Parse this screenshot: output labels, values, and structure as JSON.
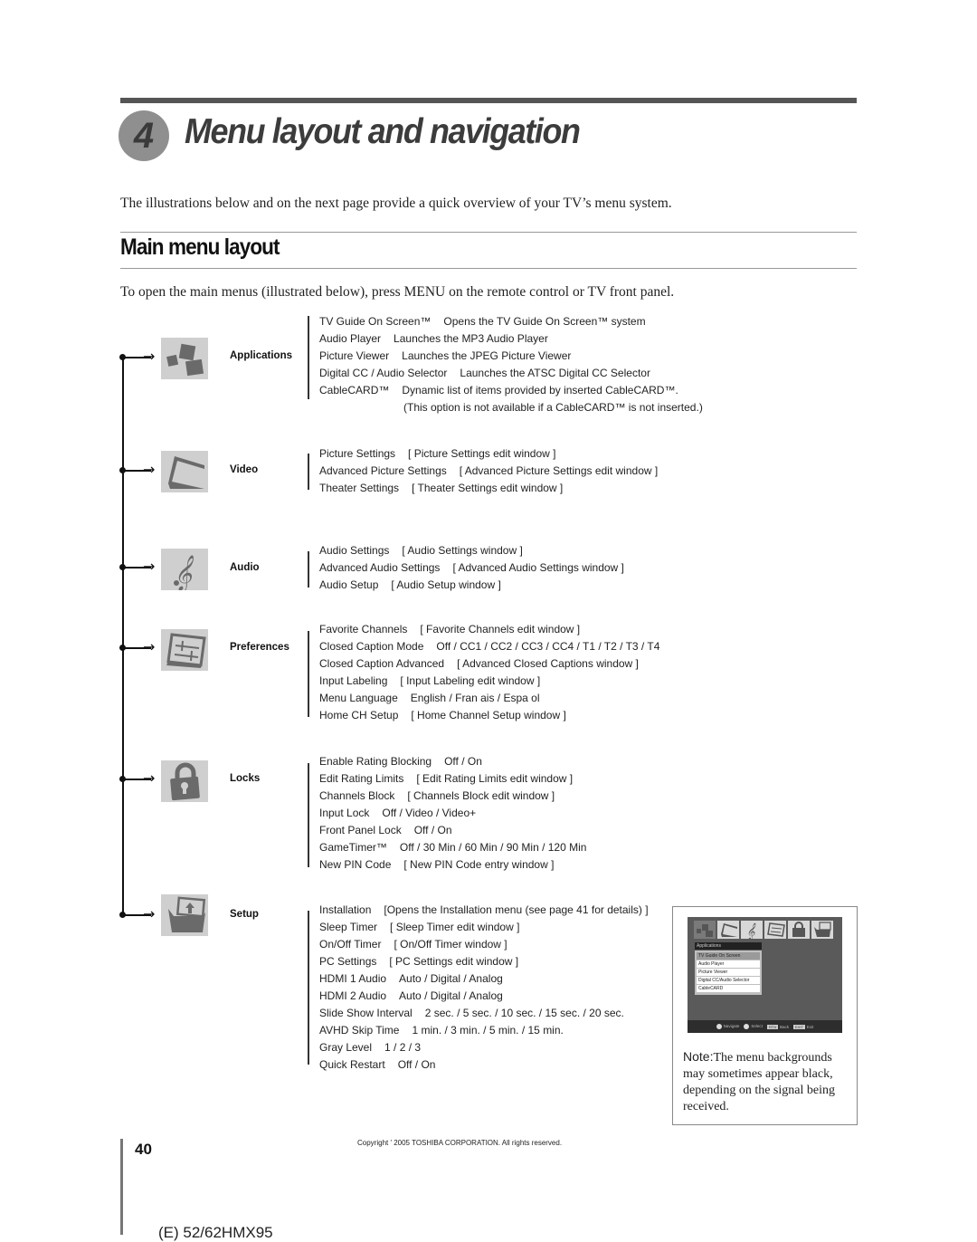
{
  "header": {
    "chapter_number": "4",
    "chapter_title": "Menu layout and navigation",
    "intro_text": "The illustrations below and on the next page provide a quick overview of your TV’s menu system."
  },
  "section": {
    "title": "Main menu layout",
    "instruction": "To open the main menus (illustrated below), press MENU on the remote control or TV front panel."
  },
  "menus": [
    {
      "label": "Applications",
      "icon": "applications-icon",
      "items": [
        {
          "name": "TV Guide On Screen™",
          "value": "Opens the TV Guide On Screen™ system"
        },
        {
          "name": "Audio Player",
          "value": "Launches the MP3 Audio Player"
        },
        {
          "name": "Picture Viewer",
          "value": "Launches the JPEG Picture Viewer"
        },
        {
          "name": "Digital CC / Audio Selector",
          "value": "Launches the ATSC Digital CC Selector"
        },
        {
          "name": "CableCARD™",
          "value": "Dynamic list of items provided by inserted CableCARD™."
        },
        {
          "name": "",
          "value": "(This option is not available if a CableCARD™ is not inserted.)"
        }
      ]
    },
    {
      "label": "Video",
      "icon": "video-icon",
      "items": [
        {
          "name": "Picture Settings",
          "value": "[ Picture Settings edit window ]"
        },
        {
          "name": "Advanced Picture Settings",
          "value": "[ Advanced Picture Settings edit window ]"
        },
        {
          "name": "Theater Settings",
          "value": "[ Theater Settings edit window ]"
        }
      ]
    },
    {
      "label": "Audio",
      "icon": "audio-icon",
      "items": [
        {
          "name": "Audio Settings",
          "value": "[ Audio Settings window ]"
        },
        {
          "name": "Advanced Audio Settings",
          "value": "[ Advanced Audio Settings window ]"
        },
        {
          "name": "Audio Setup",
          "value": "[ Audio Setup window ]"
        }
      ]
    },
    {
      "label": "Preferences",
      "icon": "preferences-icon",
      "items": [
        {
          "name": "Favorite Channels",
          "value": "[ Favorite Channels edit window ]"
        },
        {
          "name": "Closed Caption Mode",
          "value": "Off / CC1 / CC2 / CC3 / CC4 / T1 / T2 / T3 / T4"
        },
        {
          "name": "Closed Caption Advanced",
          "value": "[ Advanced Closed Captions window ]"
        },
        {
          "name": "Input Labeling",
          "value": "[ Input Labeling edit window ]"
        },
        {
          "name": "Menu Language",
          "value": "English / Fran ais / Espa ol"
        },
        {
          "name": "Home CH Setup",
          "value": "[ Home Channel Setup window ]"
        }
      ]
    },
    {
      "label": "Locks",
      "icon": "lock-icon",
      "items": [
        {
          "name": "Enable Rating Blocking",
          "value": "Off / On"
        },
        {
          "name": "Edit Rating Limits",
          "value": "[ Edit Rating Limits edit window ]"
        },
        {
          "name": "Channels Block",
          "value": "[ Channels Block edit window ]"
        },
        {
          "name": "Input Lock",
          "value": "Off / Video / Video+"
        },
        {
          "name": "Front Panel Lock",
          "value": "Off / On"
        },
        {
          "name": "GameTimer™",
          "value": "Off / 30 Min / 60 Min / 90 Min / 120 Min"
        },
        {
          "name": "New PIN Code",
          "value": "[ New PIN Code entry window ]"
        }
      ]
    },
    {
      "label": "Setup",
      "icon": "setup-icon",
      "items": [
        {
          "name": "Installation",
          "value": "[Opens the Installation menu (see page 41 for details) ]"
        },
        {
          "name": "Sleep Timer",
          "value": "[ Sleep Timer edit window ]"
        },
        {
          "name": "On/Off Timer",
          "value": "[ On/Off Timer window ]"
        },
        {
          "name": "PC Settings",
          "value": "[ PC Settings edit window ]"
        },
        {
          "name": "HDMI 1 Audio",
          "value": "Auto / Digital / Analog"
        },
        {
          "name": "HDMI 2 Audio",
          "value": "Auto / Digital / Analog"
        },
        {
          "name": "Slide Show Interval",
          "value": "2 sec. / 5 sec. / 10 sec. / 15 sec. / 20 sec."
        },
        {
          "name": "AVHD Skip Time",
          "value": "1 min. / 3 min. / 5 min. / 15 min."
        },
        {
          "name": "Gray Level",
          "value": "1 / 2 / 3"
        },
        {
          "name": "Quick Restart",
          "value": "Off / On"
        }
      ]
    }
  ],
  "screenshot": {
    "menu_title": "Applications",
    "items": [
      "TV Guide On Screen",
      "Audio Player",
      "Picture Viewer",
      "Digital CC/Audio Selector",
      "CableCARD"
    ],
    "selected_index": 0,
    "footer": {
      "navigate": "Navigate",
      "select": "Select",
      "back_key": "RTN",
      "back": "Back",
      "exit_key": "EXIT",
      "exit": "Exit"
    }
  },
  "note": {
    "label": "Note:",
    "text": "The menu backgrounds may sometimes appear black, depending on the signal being received."
  },
  "footer": {
    "page_number": "40",
    "copyright": "Copyright ' 2005 TOSHIBA CORPORATION. All rights reserved.",
    "model": "(E) 52/62HMX95"
  }
}
